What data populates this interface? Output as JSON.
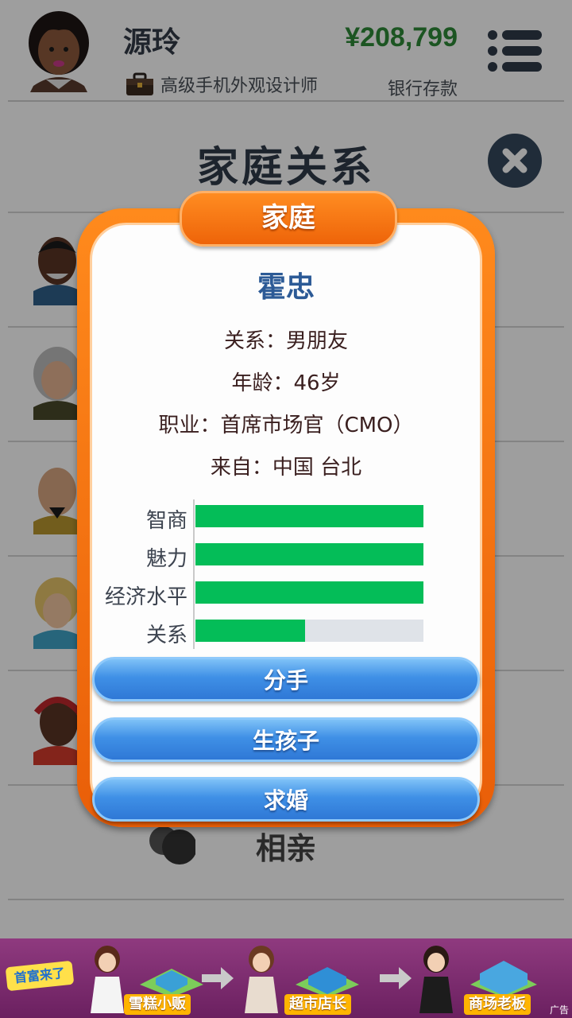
{
  "header": {
    "player_name": "源玲",
    "job_title": "高级手机外观设计师",
    "money": "¥208,799",
    "money_label": "银行存款"
  },
  "page": {
    "title": "家庭关系",
    "blind_date_label": "相亲"
  },
  "modal": {
    "tab_label": "家庭",
    "person_name": "霍忠",
    "relation_line": "关系：男朋友",
    "age_line": "年龄：46岁",
    "job_line": "职业：首席市场官（CMO）",
    "from_line": "来自：中国 台北",
    "stats": [
      {
        "label": "智商",
        "fraction": 1.0
      },
      {
        "label": "魅力",
        "fraction": 1.0
      },
      {
        "label": "经济水平",
        "fraction": 1.0
      },
      {
        "label": "关系",
        "fraction": 0.48
      }
    ],
    "buttons": {
      "break_up": "分手",
      "have_child": "生孩子",
      "propose": "求婚"
    }
  },
  "ad": {
    "logo": "首富来了",
    "stage1": "雪糕小贩",
    "stage2": "超市店长",
    "stage3": "商场老板",
    "badge": "广告"
  },
  "colors": {
    "money_green": "#2e8a38",
    "modal_orange": "#ee6409",
    "stat_green": "#04bd58",
    "button_blue": "#3f90e6",
    "name_blue": "#2c5a96"
  },
  "icons": [
    "menu-icon",
    "close-icon",
    "briefcase-icon",
    "couple-silhouette-icon"
  ]
}
